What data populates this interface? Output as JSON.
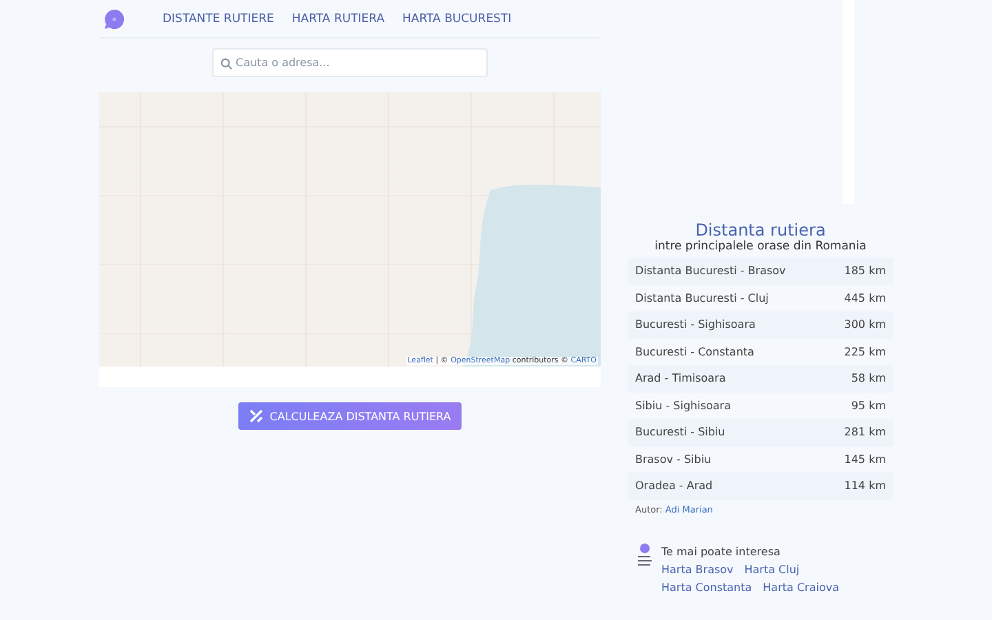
{
  "nav": {
    "items": [
      {
        "label": "DISTANTE RUTIERE"
      },
      {
        "label": "HARTA RUTIERA"
      },
      {
        "label": "HARTA BUCURESTI"
      }
    ]
  },
  "search": {
    "placeholder": "Cauta o adresa..."
  },
  "map": {
    "attribution": [
      {
        "label": "Leaflet",
        "link": true
      },
      {
        "label": " | © ",
        "link": false
      },
      {
        "label": "OpenStreetMap",
        "link": true
      },
      {
        "label": " contributors © ",
        "link": false
      },
      {
        "label": "CARTO",
        "link": true
      }
    ]
  },
  "calculate_button": {
    "label": "CALCULEAZA DISTANTA RUTIERA"
  },
  "distances": {
    "title": "Distanta rutiera",
    "subtitle": "intre principalele orase din Romania",
    "rows": [
      {
        "route": "Distanta Bucuresti - Brasov",
        "distance": "185 km"
      },
      {
        "route": "Distanta Bucuresti - Cluj",
        "distance": "445 km"
      },
      {
        "route": "Bucuresti - Sighisoara",
        "distance": "300 km"
      },
      {
        "route": "Bucuresti - Constanta",
        "distance": "225 km"
      },
      {
        "route": "Arad - Timisoara",
        "distance": "58 km"
      },
      {
        "route": "Sibiu - Sighisoara",
        "distance": "95 km"
      },
      {
        "route": "Bucuresti - Sibiu",
        "distance": "281 km"
      },
      {
        "route": "Brasov - Sibiu",
        "distance": "145 km"
      },
      {
        "route": "Oradea - Arad",
        "distance": "114 km"
      }
    ],
    "author_label": "Autor:",
    "author": "Adi Marian"
  },
  "related": {
    "title": "Te mai poate interesa",
    "links": [
      [
        "Harta Brasov",
        "Harta Cluj"
      ],
      [
        "Harta Constanta",
        "Harta Craiova"
      ]
    ]
  }
}
